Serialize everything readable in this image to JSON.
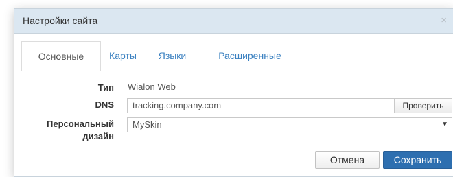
{
  "dialog": {
    "title": "Настройки сайта",
    "close_glyph": "×"
  },
  "tabs": [
    {
      "label": "Основные",
      "active": true
    },
    {
      "label": "Карты",
      "active": false
    },
    {
      "label": "Языки",
      "active": false
    },
    {
      "label": "Расширенные",
      "active": false
    }
  ],
  "form": {
    "type_label": "Тип",
    "type_value": "Wialon Web",
    "dns_label": "DNS",
    "dns_value": "tracking.company.com",
    "check_button": "Проверить",
    "design_label_line1": "Персональный",
    "design_label_line2": "дизайн",
    "design_value": "MySkin",
    "select_arrow": "▼"
  },
  "actions": {
    "cancel_label": "Отмена",
    "save_label": "Сохранить"
  },
  "colors": {
    "titlebar_bg": "#dbe7f1",
    "link": "#3a80c0",
    "primary": "#2e6fb0"
  },
  "icons": {
    "close": "close-icon",
    "dropdown": "chevron-down-icon"
  }
}
